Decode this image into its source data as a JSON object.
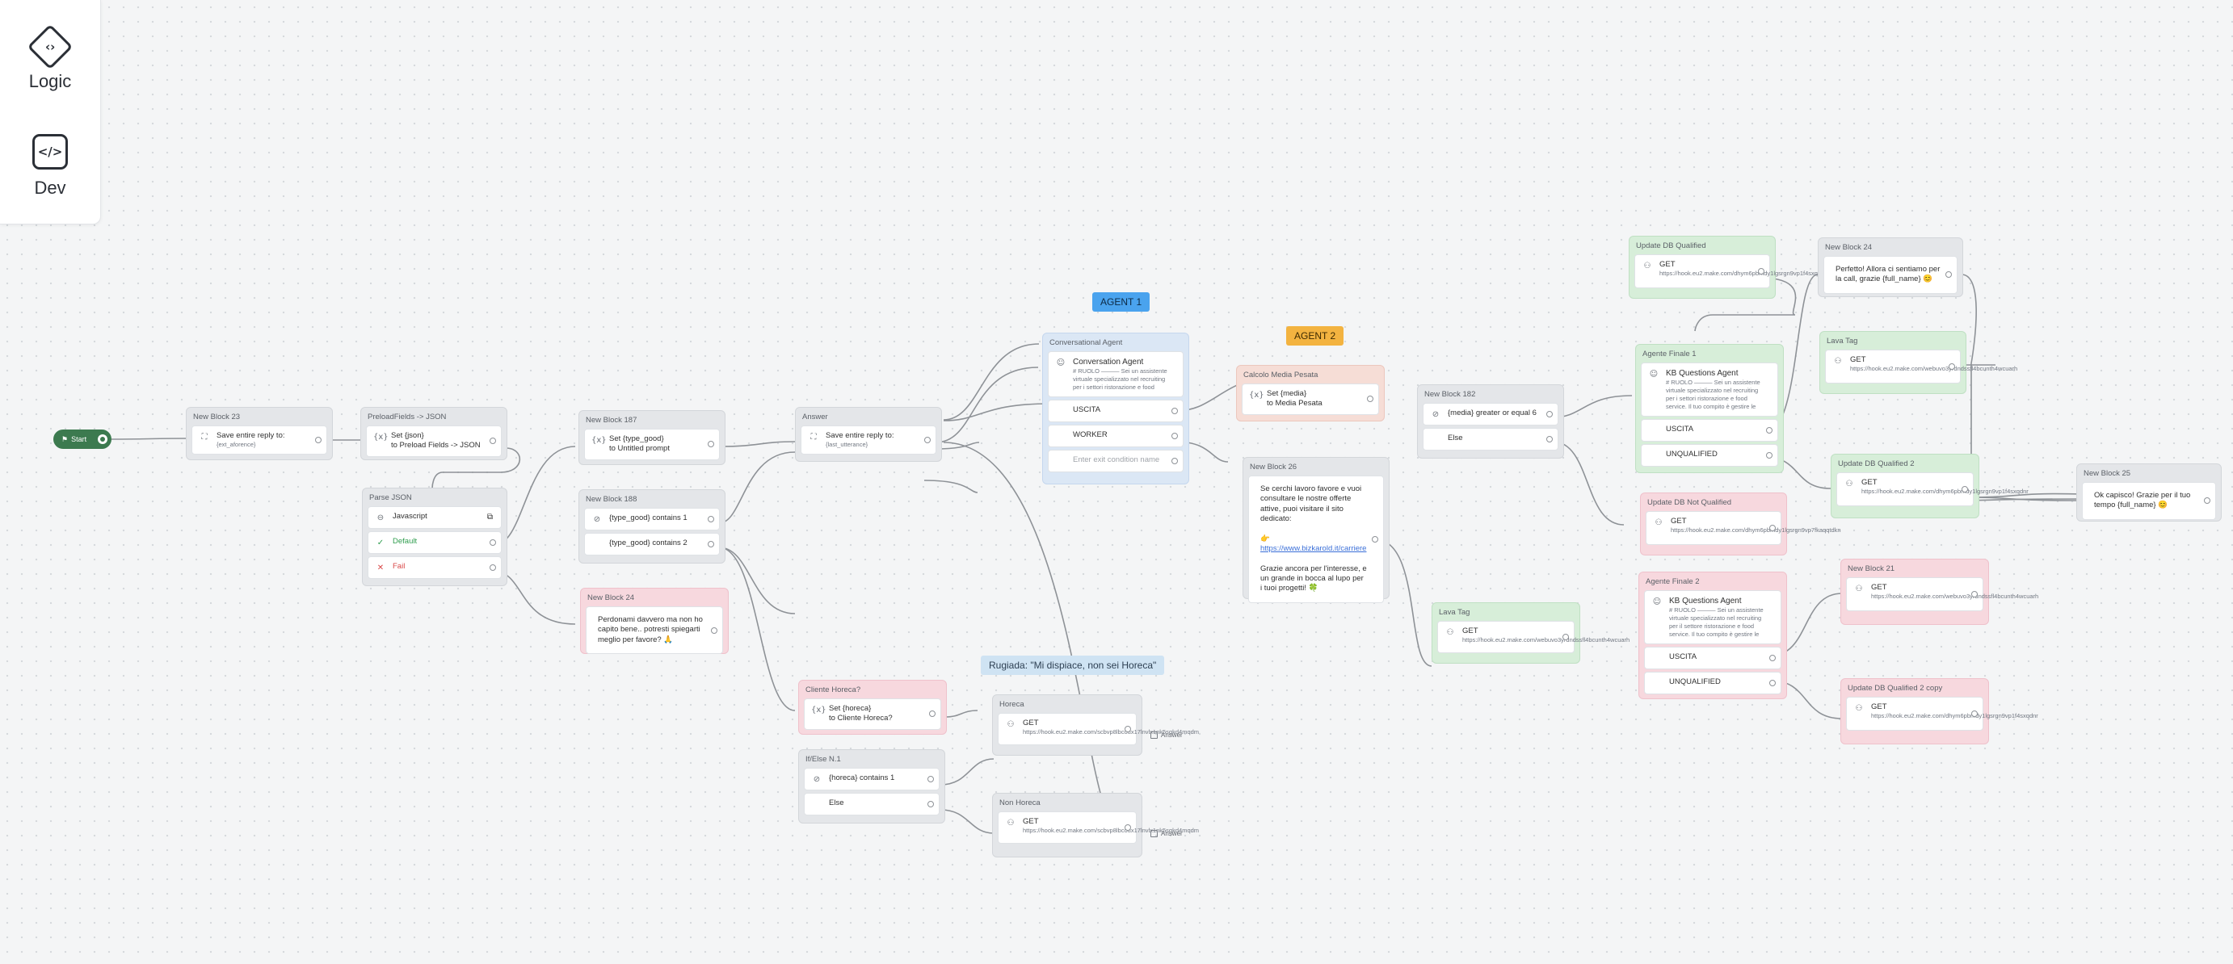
{
  "sidebar": {
    "tools": [
      {
        "label": "Logic",
        "icon": "logic-icon"
      },
      {
        "label": "Dev",
        "icon": "code-icon"
      }
    ]
  },
  "start": {
    "label": "Start"
  },
  "badges": {
    "agent1": "AGENT 1",
    "agent2": "AGENT 2",
    "note": "Rugiada: \"Mi dispiace, non sei Horeca\""
  },
  "answer_tag": "Answer",
  "groups": {
    "nb23": {
      "title": "New Block 23",
      "line1": "Save entire reply to:",
      "line2": "{ext_aforence}"
    },
    "preload": {
      "title": "PreloadFields -> JSON",
      "line1": "Set {json}",
      "line2": "to Preload Fields -> JSON"
    },
    "parse": {
      "title": "Parse JSON",
      "items": [
        "Javascript",
        "Default",
        "Fail"
      ]
    },
    "nb187": {
      "title": "New Block 187",
      "line1": "Set {type_good}",
      "line2": "to Untitled prompt"
    },
    "nb188": {
      "title": "New Block 188",
      "items": [
        "{type_good} contains 1",
        "{type_good} contains 2"
      ]
    },
    "nb24": {
      "title": "New Block 24",
      "text": "Perdonami davvero ma non ho capito bene.. potresti spiegarti meglio per favore? 🙏"
    },
    "answer": {
      "title": "Answer",
      "line1": "Save entire reply to:",
      "line2": "{last_utterance}"
    },
    "convAgent": {
      "title": "Conversational Agent",
      "name": "Conversation Agent",
      "desc": "# RUOLO ——— Sei un assistente virtuale specializzato nel recruiting per i settori ristorazione e food service. Il tuo ruolo è aiutare una chiacchierata...",
      "items": [
        "USCITA",
        "WORKER"
      ],
      "placeholder": "Enter exit condition name"
    },
    "calcolo": {
      "title": "Calcolo Media Pesata",
      "line1": "Set {media}",
      "line2": "to Media Pesata"
    },
    "nb26": {
      "title": "New Block 26",
      "text1": "Se cerchi lavoro favore e vuoi consultare le nostre offerte attive, puoi visitare il sito dedicato:",
      "emoji": "👉",
      "link": "https://www.bizkarold.it/carriere",
      "text2": "Grazie ancora per l'interesse, e un grande in bocca al lupo per i tuoi progetti! 🍀"
    },
    "nb182": {
      "title": "New Block 182",
      "items": [
        "{media} greater or equal 6",
        "Else"
      ]
    },
    "leavTag1": {
      "title": "Lava Tag",
      "method": "GET",
      "url": "https://hook.eu2.make.com/webuvo3yrdndssfl4bcunth4wcuarh"
    },
    "clienteHoreca": {
      "title": "Cliente Horeca?",
      "line1": "Set {horeca}",
      "line2": "to Cliente Horeca?"
    },
    "ifElse": {
      "title": "If/Else N.1",
      "items": [
        "{horeca} contains 1",
        "Else"
      ]
    },
    "horeca": {
      "title": "Horeca",
      "method": "GET",
      "url": "https://hook.eu2.make.com/scbvp8lbcoux17lnvlx1nk5sqkd4mqdm"
    },
    "nonHoreca": {
      "title": "Non Horeca",
      "method": "GET",
      "url": "https://hook.eu2.make.com/scbvp8lbcoux17lnvlx1nk5sqkd4mqdm"
    },
    "updQual": {
      "title": "Update DB Qualified",
      "method": "GET",
      "url": "https://hook.eu2.make.com/dhym6pbmdy1lgsrgn9vp1f4sxqdnr"
    },
    "agenteFinale1": {
      "title": "Agente Finale 1",
      "name": "KB Questions Agent",
      "desc": "# RUOLO ——— Sei un assistente virtuale specializzato nel recruiting per i settori ristorazione e food service. Il tuo compito è gestire le domande...",
      "items": [
        "USCITA",
        "UNQUALIFIED"
      ]
    },
    "updNotQual": {
      "title": "Update DB Not Qualified",
      "method": "GET",
      "url": "https://hook.eu2.make.com/dhym6pbmdy1lgsrgn9vp7fkaqqtdkn"
    },
    "agenteFinale2": {
      "title": "Agente Finale 2",
      "name": "KB Questions Agent",
      "desc": "# RUOLO ——— Sei un assistente virtuale specializzato nel recruiting per il settore ristorazione e food service. Il tuo compito è gestire le domande...",
      "items": [
        "USCITA",
        "UNQUALIFIED"
      ]
    },
    "nb24b": {
      "title": "New Block 24",
      "text": "Perfetto! Allora ci sentiamo per la call, grazie {full_name} 😊"
    },
    "leavTag2": {
      "title": "Lava Tag",
      "method": "GET",
      "url": "https://hook.eu2.make.com/webuvo3yrdndssfl4bcunth4wcuarh"
    },
    "updQual2": {
      "title": "Update DB Qualified 2",
      "method": "GET",
      "url": "https://hook.eu2.make.com/dhym6pbmdy1lgsrgn9vp1f4sxqdnr"
    },
    "nb21": {
      "title": "New Block 21",
      "method": "GET",
      "url": "https://hook.eu2.make.com/webuvo3yrdndssfl4bcunth4wcuarh"
    },
    "updQual2copy": {
      "title": "Update DB Qualified 2 copy",
      "method": "GET",
      "url": "https://hook.eu2.make.com/dhym6pbmdy1lgsrgn9vp1f4sxqdnr"
    },
    "nb25": {
      "title": "New Block 25",
      "text": "Ok capisco! Grazie per il tuo tempo {full_name} 😊"
    }
  }
}
